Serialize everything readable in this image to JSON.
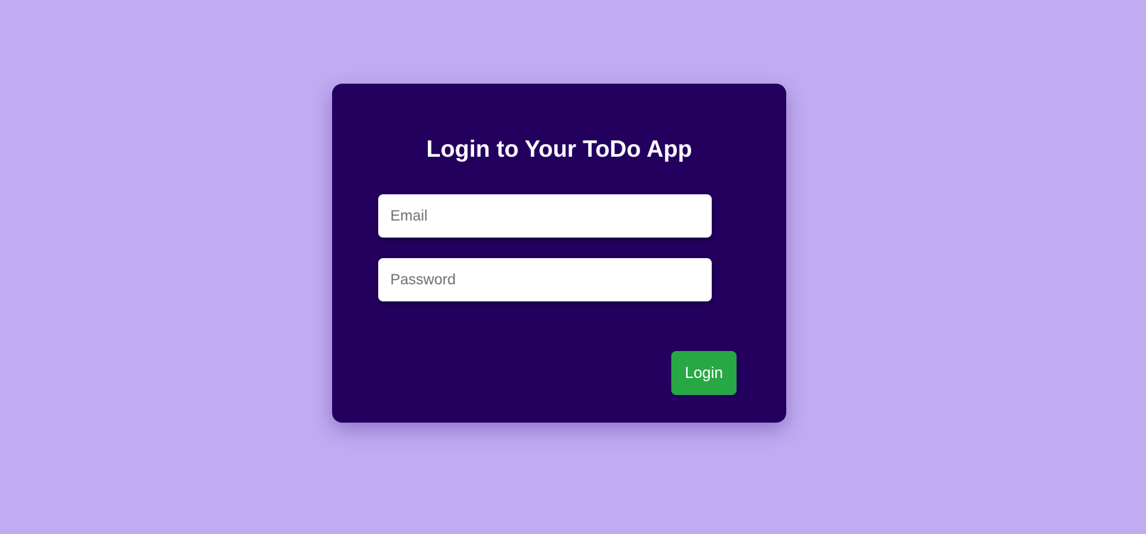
{
  "login_form": {
    "title": "Login to Your ToDo App",
    "email": {
      "placeholder": "Email",
      "value": ""
    },
    "password": {
      "placeholder": "Password",
      "value": ""
    },
    "submit_label": "Login"
  },
  "colors": {
    "page_background": "#c1acf2",
    "card_background": "#23005e",
    "button_background": "#28a745",
    "text_light": "#ffffff"
  }
}
